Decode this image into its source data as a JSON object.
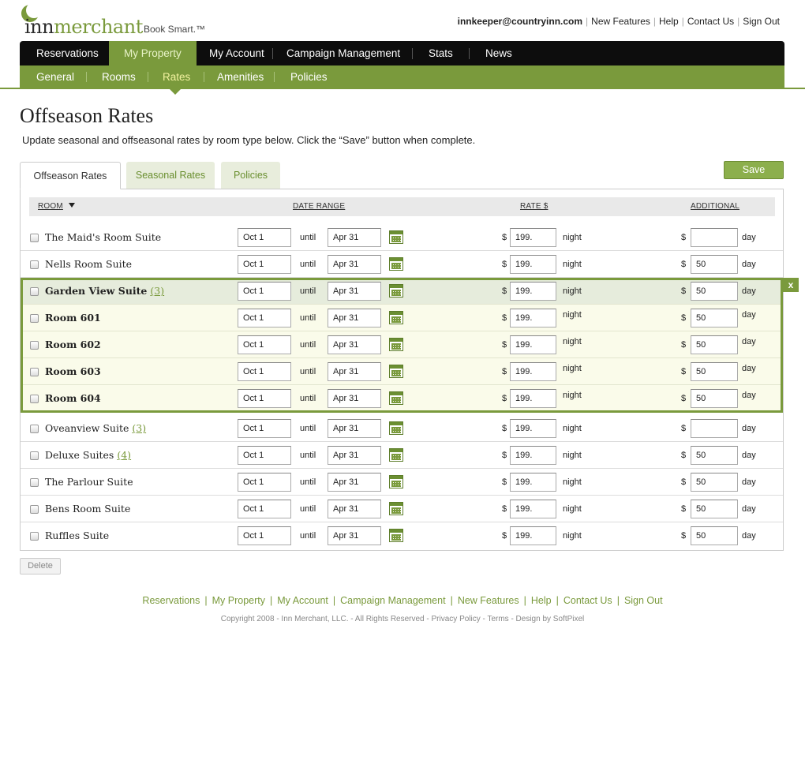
{
  "brand": {
    "name_part1": "inn",
    "name_part2": "merchant",
    "tagline": "Book Smart.™"
  },
  "toplinks": {
    "email": "innkeeper@countryinn.com",
    "items": [
      "New Features",
      "Help",
      "Contact Us",
      "Sign Out"
    ]
  },
  "mainnav": [
    "Reservations",
    "My Property",
    "My Account",
    "Campaign Management",
    "Stats",
    "News"
  ],
  "subnav": [
    "General",
    "Rooms",
    "Rates",
    "Amenities",
    "Policies"
  ],
  "page": {
    "title": "Offseason Rates",
    "intro": "Update seasonal and offseasonal rates by room type below. Click the “Save” button when complete."
  },
  "tabs": [
    "Offseason Rates",
    "Seasonal Rates",
    "Policies"
  ],
  "save_label": "Save",
  "delete_label": "Delete",
  "close_label": "x",
  "table": {
    "headers": {
      "room": "ROOM",
      "date_range": "DATE RANGE",
      "rate": "RATE $",
      "additional": "ADDITIONAL"
    },
    "until_label": "until",
    "currency": "$",
    "night_label": "night",
    "day_label": "day",
    "rows": [
      {
        "name": "The Maid's Room Suite",
        "count": "",
        "from": "Oct 1",
        "to": "Apr 31",
        "rate": "199.",
        "additional": ""
      },
      {
        "name": "Nells Room Suite",
        "count": "",
        "from": "Oct 1",
        "to": "Apr 31",
        "rate": "199.",
        "additional": "50"
      },
      {
        "name": "Garden View Suite",
        "count": "(3)",
        "from": "Oct 1",
        "to": "Apr 31",
        "rate": "199.",
        "additional": "50"
      },
      {
        "name": "Room 601",
        "count": "",
        "from": "Oct 1",
        "to": "Apr 31",
        "rate": "199.",
        "additional": "50"
      },
      {
        "name": "Room 602",
        "count": "",
        "from": "Oct 1",
        "to": "Apr 31",
        "rate": "199.",
        "additional": "50"
      },
      {
        "name": "Room 603",
        "count": "",
        "from": "Oct 1",
        "to": "Apr 31",
        "rate": "199.",
        "additional": "50"
      },
      {
        "name": "Room 604",
        "count": "",
        "from": "Oct 1",
        "to": "Apr 31",
        "rate": "199.",
        "additional": "50"
      },
      {
        "name": "Oveanview Suite",
        "count": "(3)",
        "from": "Oct 1",
        "to": "Apr 31",
        "rate": "199.",
        "additional": ""
      },
      {
        "name": "Deluxe Suites",
        "count": "(4)",
        "from": "Oct 1",
        "to": "Apr 31",
        "rate": "199.",
        "additional": "50"
      },
      {
        "name": "The Parlour Suite",
        "count": "",
        "from": "Oct 1",
        "to": "Apr 31",
        "rate": "199.",
        "additional": "50"
      },
      {
        "name": "Bens Room Suite",
        "count": "",
        "from": "Oct 1",
        "to": "Apr 31",
        "rate": "199.",
        "additional": "50"
      },
      {
        "name": "Ruffles Suite",
        "count": "",
        "from": "Oct 1",
        "to": "Apr 31",
        "rate": "199.",
        "additional": "50"
      }
    ]
  },
  "footer": {
    "links": [
      "Reservations",
      "My Property",
      "My Account",
      "Campaign Management",
      "New Features",
      "Help",
      "Contact Us",
      "Sign Out"
    ],
    "copyright": "Copyright 2008 - Inn Merchant, LLC. - All Rights Reserved - Privacy Policy - Terms - Design by SoftPixel"
  },
  "colors": {
    "accent": "#7a9a3c",
    "nav_bg": "#0d0d0d",
    "group_head_bg": "#e6ecdc",
    "group_child_bg": "#fafbea"
  }
}
